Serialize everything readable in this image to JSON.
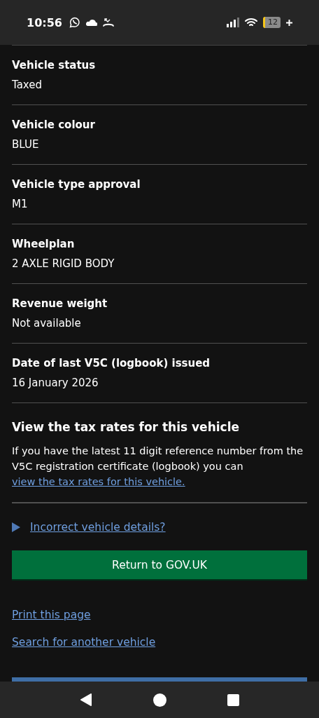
{
  "status_bar": {
    "time": "10:56",
    "battery": "12"
  },
  "rows": [
    {
      "label": "Vehicle status",
      "value": "Taxed"
    },
    {
      "label": "Vehicle colour",
      "value": "BLUE"
    },
    {
      "label": "Vehicle type approval",
      "value": "M1"
    },
    {
      "label": "Wheelplan",
      "value": "2 AXLE RIGID BODY"
    },
    {
      "label": "Revenue weight",
      "value": "Not available"
    },
    {
      "label": "Date of last V5C (logbook) issued",
      "value": "16 January 2026"
    }
  ],
  "tax_section": {
    "heading": "View the tax rates for this vehicle",
    "text": "If you have the latest 11 digit reference number from the V5C registration certificate (logbook) you can",
    "link": "view the tax rates for this vehicle."
  },
  "details": {
    "summary": "Incorrect vehicle details?",
    "expanded": false
  },
  "return_button": "Return to GOV.UK",
  "links": [
    "Print this page",
    "Search for another vehicle"
  ]
}
